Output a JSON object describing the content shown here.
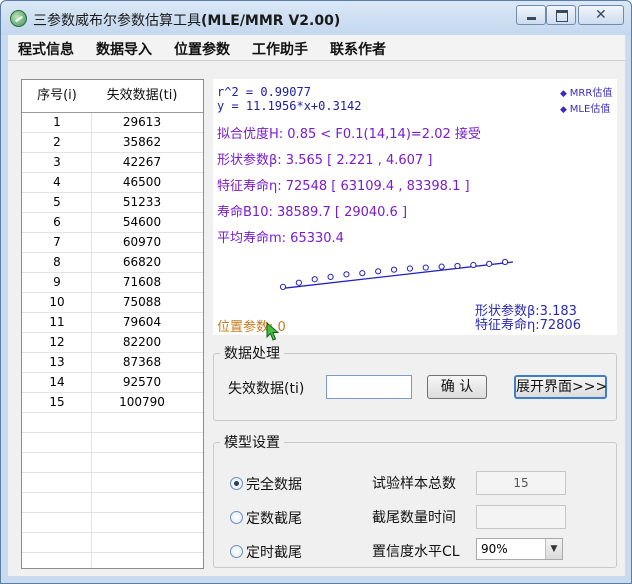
{
  "window": {
    "title_cn": "三参数威布尔参数估算工具",
    "title_en": "(MLE/MMR V2.00)"
  },
  "menu": [
    {
      "label": "程式信息"
    },
    {
      "label": "数据导入"
    },
    {
      "label": "位置参数"
    },
    {
      "label": "工作助手"
    },
    {
      "label": "联系作者"
    }
  ],
  "table": {
    "col_seq": "序号(i)",
    "col_data": "失效数据(ti)",
    "rows": [
      {
        "i": "1",
        "t": "29613"
      },
      {
        "i": "2",
        "t": "35862"
      },
      {
        "i": "3",
        "t": "42267"
      },
      {
        "i": "4",
        "t": "46500"
      },
      {
        "i": "5",
        "t": "51233"
      },
      {
        "i": "6",
        "t": "54600"
      },
      {
        "i": "7",
        "t": "60970"
      },
      {
        "i": "8",
        "t": "66820"
      },
      {
        "i": "9",
        "t": "71608"
      },
      {
        "i": "10",
        "t": "75088"
      },
      {
        "i": "11",
        "t": "79604"
      },
      {
        "i": "12",
        "t": "82200"
      },
      {
        "i": "13",
        "t": "87368"
      },
      {
        "i": "14",
        "t": "92570"
      },
      {
        "i": "15",
        "t": "100790"
      }
    ]
  },
  "results": {
    "r2": "r^2 = 0.99077",
    "equation": "y = 11.1956*x+0.3142",
    "legend_mrr": "MRR估值",
    "legend_mle": "MLE估值",
    "fit": "拟合优度H: 0.85 < F0.1(14,14)=2.02 接受",
    "shape": "形状参数β: 3.565  [ 2.221 , 4.607 ]",
    "scale": "特征寿命η: 72548  [ 63109.4 , 83398.1 ]",
    "b10": "寿命B10: 38589.7 [ 29040.6 ]",
    "mean": "平均寿命m: 65330.4",
    "shape_mle": "形状参数β:3.183",
    "scale_mle": "特征寿命η:72806",
    "location": "位置参数: 0",
    "colors": {
      "result_text": "#7a1bd0",
      "regression_text": "#2020a0",
      "location_text": "#c87a1a",
      "fit_line": "#2222c0"
    }
  },
  "chart_data": {
    "type": "scatter",
    "title": "",
    "xlabel": "",
    "ylabel": "",
    "grid": false,
    "series": [
      {
        "name": "MRR估值",
        "x": [
          0,
          1,
          2,
          3,
          4,
          5,
          6,
          7,
          8,
          9,
          10,
          11,
          12,
          13,
          14
        ],
        "y": [
          0.9,
          2.7,
          4.2,
          5.2,
          6.3,
          6.8,
          7.6,
          8.3,
          8.8,
          9.2,
          9.6,
          9.9,
          10.3,
          10.8,
          11.6
        ]
      }
    ],
    "fit_line": {
      "from": [
        0,
        0.3
      ],
      "to": [
        14.5,
        11.6
      ]
    }
  },
  "processing": {
    "group_title": "数据处理",
    "input_label": "失效数据(ti)",
    "input_value": "",
    "confirm_label": "确 认",
    "expand_label": "展开界面>>>"
  },
  "model": {
    "group_title": "模型设置",
    "radio_complete": "完全数据",
    "radio_count_censor": "定数截尾",
    "radio_time_censor": "定时截尾",
    "selected": "complete",
    "sample_total_label": "试验样本总数",
    "sample_total_value": "15",
    "censor_label": "截尾数量时间",
    "censor_value": "",
    "confidence_label": "置信度水平CL",
    "confidence_value": "90%"
  }
}
